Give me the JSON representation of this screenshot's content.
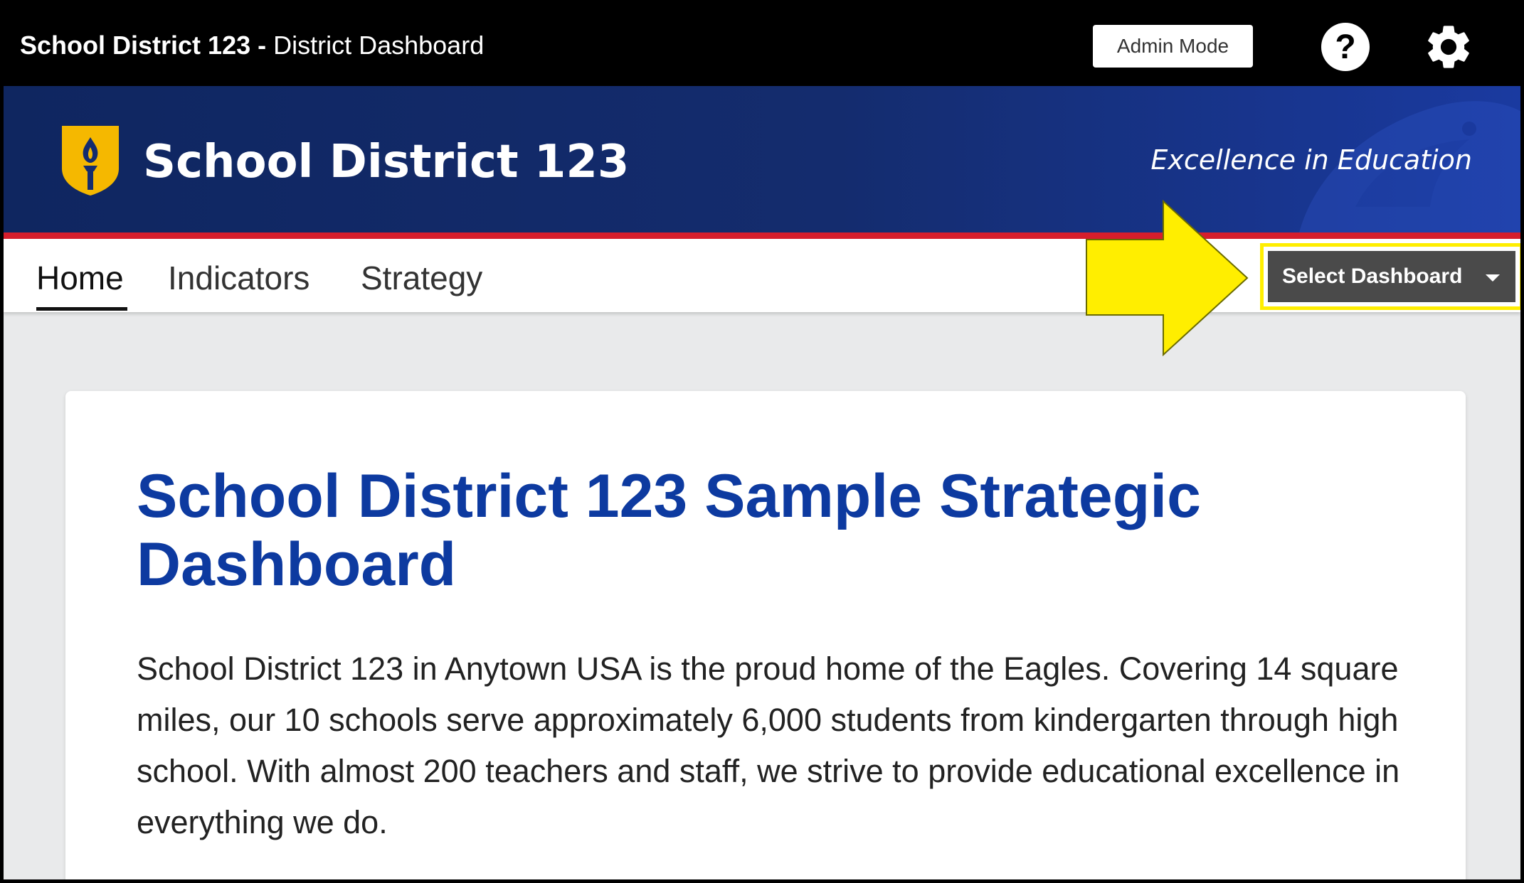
{
  "topbar": {
    "title_bold": "School District 123 -",
    "title_rest": " District Dashboard",
    "admin_mode_label": "Admin Mode",
    "help_label": "?"
  },
  "banner": {
    "district_name": "School District 123",
    "tagline": "Excellence in Education",
    "brand_colors": {
      "navy": "#142c6e",
      "gold": "#f5b800",
      "red": "#d61e2c"
    }
  },
  "nav": {
    "tabs": [
      {
        "label": "Home",
        "active": true
      },
      {
        "label": "Indicators",
        "active": false
      },
      {
        "label": "Strategy",
        "active": false
      }
    ],
    "select_dashboard_label": "Select Dashboard"
  },
  "annotation": {
    "highlight_color": "#ffee00"
  },
  "card": {
    "title": "School District 123 Sample Strategic Dashboard",
    "body": "School District 123 in Anytown USA is the proud home of the Eagles. Covering 14 square miles, our 10 schools serve approximately 6,000 students from kindergarten through high school. With almost 200 teachers and staff, we strive to provide educational excellence in everything we do."
  }
}
